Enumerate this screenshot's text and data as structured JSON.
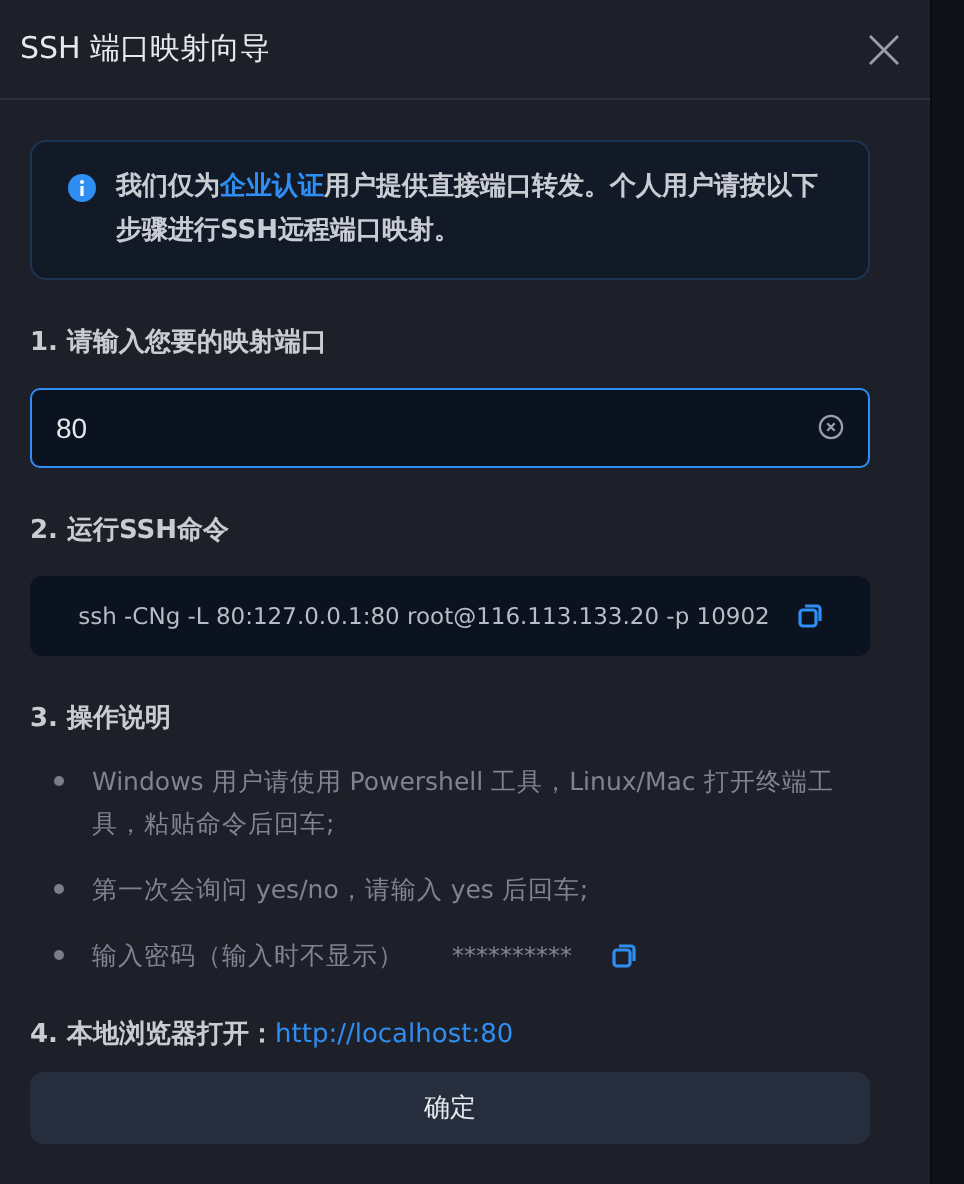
{
  "dialog": {
    "title": "SSH 端口映射向导",
    "notice": {
      "before": "我们仅为",
      "link": "企业认证",
      "after": "用户提供直接端口转发。个人用户请按以下步骤进行SSH远程端口映射。"
    },
    "steps": [
      {
        "kind": "input",
        "label": "1. 请输入您要的映射端口",
        "value": "80"
      },
      {
        "kind": "command",
        "label": "2. 运行SSH命令",
        "command": "ssh -CNg -L 80:127.0.0.1:80 root@116.113.133.20 -p 10902"
      },
      {
        "kind": "list",
        "label": "3. 操作说明",
        "items": [
          {
            "text": "Windows 用户请使用 Powershell 工具，Linux/Mac 打开终端工具，粘贴命令后回车;"
          },
          {
            "text": "第一次会询问 yes/no，请输入 yes 后回车;"
          },
          {
            "text": "输入密码（输入时不显示）",
            "secret": "**********"
          }
        ]
      },
      {
        "kind": "link",
        "label": "4. 本地浏览器打开：",
        "url": "http://localhost:80"
      }
    ],
    "confirm": "确定"
  }
}
